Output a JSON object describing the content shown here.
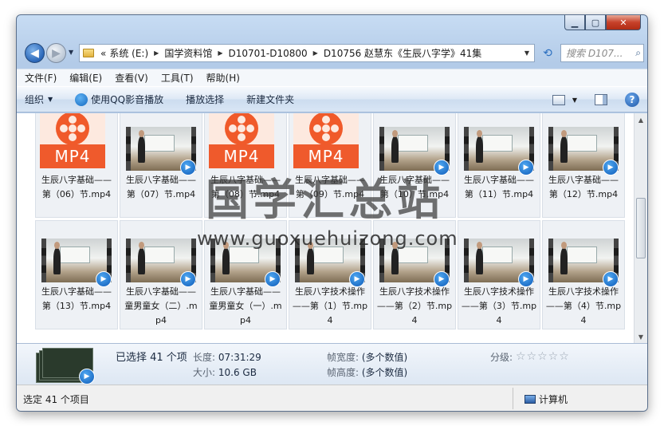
{
  "window": {
    "minimize": "▁",
    "maximize": "▢",
    "close": "✕"
  },
  "address": {
    "crumbs": [
      "系统 (E:)",
      "国学资料馆",
      "D10701-D10800",
      "D10756 赵慧东《生辰八字学》41集"
    ],
    "lead": "«",
    "search_placeholder": "搜索 D107..."
  },
  "menu": [
    "文件(F)",
    "编辑(E)",
    "查看(V)",
    "工具(T)",
    "帮助(H)"
  ],
  "toolbar": {
    "organize": "组织",
    "play_qq": "使用QQ影音播放",
    "play_select": "播放选择",
    "new_folder": "新建文件夹"
  },
  "files": [
    {
      "name": "生辰八字基础——第（06）节.mp4",
      "kind": "mp4"
    },
    {
      "name": "生辰八字基础——第（07）节.mp4",
      "kind": "video"
    },
    {
      "name": "生辰八字基础——第（08）节.mp4",
      "kind": "mp4"
    },
    {
      "name": "生辰八字基础——第（09）节.mp4",
      "kind": "mp4"
    },
    {
      "name": "生辰八字基础——第（10）节.mp4",
      "kind": "video"
    },
    {
      "name": "生辰八字基础——第（11）节.mp4",
      "kind": "video"
    },
    {
      "name": "生辰八字基础——第（12）节.mp4",
      "kind": "video"
    },
    {
      "name": "生辰八字基础——第（13）节.mp4",
      "kind": "video"
    },
    {
      "name": "生辰八字基础——童男童女（二）.mp4",
      "kind": "video"
    },
    {
      "name": "生辰八字基础——童男童女（一）.mp4",
      "kind": "video"
    },
    {
      "name": "生辰八字技术操作——第（1）节.mp4",
      "kind": "video"
    },
    {
      "name": "生辰八字技术操作——第（2）节.mp4",
      "kind": "video"
    },
    {
      "name": "生辰八字技术操作——第（3）节.mp4",
      "kind": "video"
    },
    {
      "name": "生辰八字技术操作——第（4）节.mp4",
      "kind": "video"
    }
  ],
  "mp4_label": "MP4",
  "details": {
    "selected": "已选择 41 个项",
    "length_label": "长度:",
    "length_value": "07:31:29",
    "size_label": "大小:",
    "size_value": "10.6 GB",
    "fw_label": "帧宽度:",
    "fw_value": "(多个数值)",
    "fh_label": "帧高度:",
    "fh_value": "(多个数值)",
    "rating_label": "分级:",
    "stars": "☆☆☆☆☆"
  },
  "status": {
    "left": "选定 41 个项目",
    "right": "计算机"
  },
  "watermark": {
    "title": "国学汇总站",
    "url": "www.guoxuehuizong.com"
  }
}
